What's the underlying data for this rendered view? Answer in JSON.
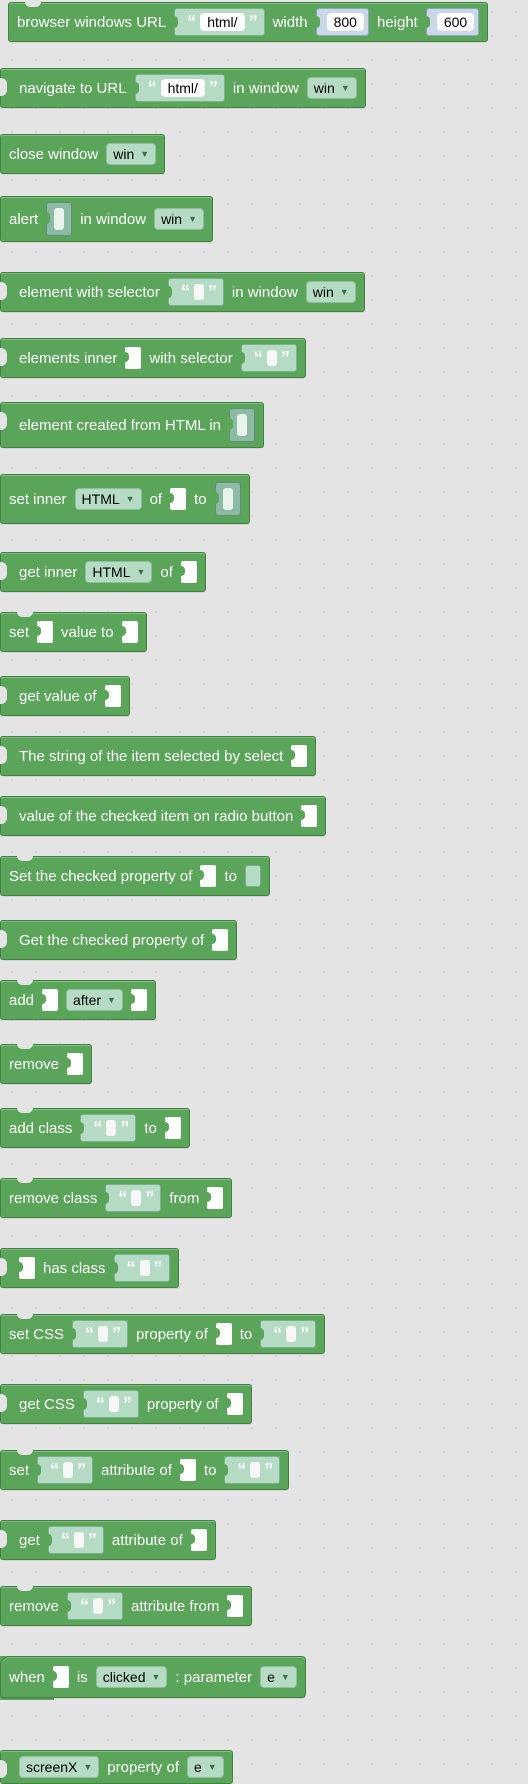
{
  "blocks": {
    "browser": {
      "label_pre": "browser windows URL",
      "url": "html/",
      "label_width": "width",
      "width": "800",
      "label_height": "height",
      "height": "600"
    },
    "navigate": {
      "label_pre": "navigate to URL",
      "url": "html/",
      "label_in": "in window",
      "window": "win"
    },
    "close": {
      "label_pre": "close window",
      "window": "win"
    },
    "alert": {
      "label_pre": "alert",
      "label_in": "in window",
      "window": "win"
    },
    "element_selector": {
      "label_pre": "element with selector",
      "label_in": "in window",
      "window": "win"
    },
    "elements_inner": {
      "label_pre": "elements inner",
      "label_mid": "with selector"
    },
    "element_created": {
      "label_pre": "element created from HTML in"
    },
    "set_inner": {
      "label_pre": "set inner",
      "prop": "HTML",
      "label_of": "of",
      "label_to": "to"
    },
    "get_inner": {
      "label_pre": "get inner",
      "prop": "HTML",
      "label_of": "of"
    },
    "set_value": {
      "label_pre": "set",
      "label_mid": "value to"
    },
    "get_value": {
      "label_pre": "get value of"
    },
    "string_selected": {
      "label_pre": "The string of the item selected by select"
    },
    "value_checked": {
      "label_pre": "value of the checked item on radio button"
    },
    "set_checked": {
      "label_pre": "Set the checked property of",
      "label_to": "to"
    },
    "get_checked": {
      "label_pre": "Get the checked property of"
    },
    "add": {
      "label_pre": "add",
      "position": "after"
    },
    "remove": {
      "label_pre": "remove"
    },
    "add_class": {
      "label_pre": "add class",
      "label_to": "to"
    },
    "remove_class": {
      "label_pre": "remove class",
      "label_from": "from"
    },
    "has_class": {
      "label_mid": "has class"
    },
    "set_css": {
      "label_pre": "set CSS",
      "label_prop": "property of",
      "label_to": "to"
    },
    "get_css": {
      "label_pre": "get CSS",
      "label_prop": "property of"
    },
    "set_attr": {
      "label_pre": "set",
      "label_attr": "attribute of",
      "label_to": "to"
    },
    "get_attr": {
      "label_pre": "get",
      "label_attr": "attribute of"
    },
    "remove_attr": {
      "label_pre": "remove",
      "label_attr": "attribute from"
    },
    "when": {
      "label_pre": "when",
      "label_is": "is",
      "event": "clicked",
      "label_param": ": parameter",
      "param": "e"
    },
    "screenx": {
      "property": "screenX",
      "label_of": "property of",
      "param": "e"
    }
  },
  "colors": {
    "block": "#5ba55b",
    "block_border": "#418441",
    "socket": "#b6dbc4",
    "workspace": "#e4e4e4"
  }
}
